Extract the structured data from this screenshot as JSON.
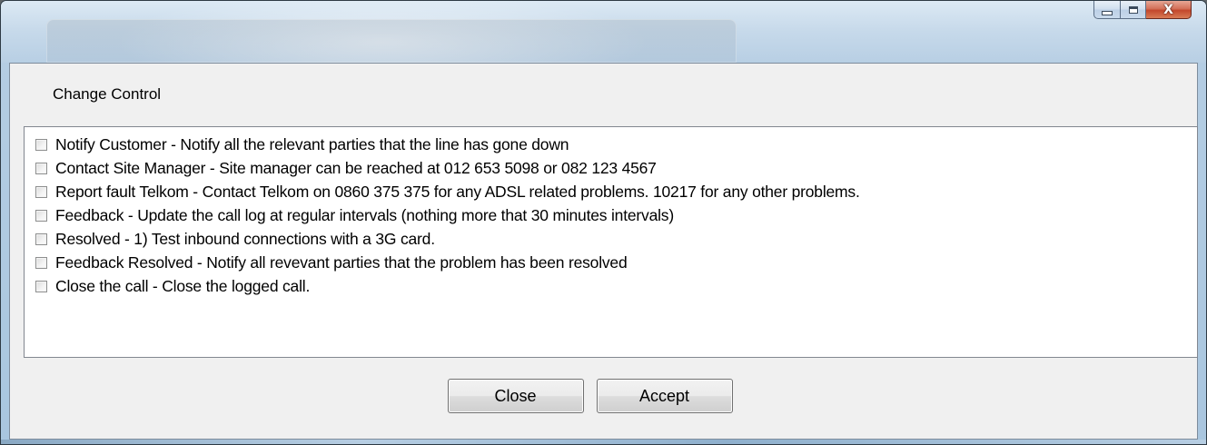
{
  "window": {
    "caption_buttons": {
      "minimize_icon": "minimize-icon",
      "maximize_icon": "maximize-icon",
      "close_icon": "close-icon",
      "close_glyph": "X"
    },
    "colors": {
      "close_button": "#c3472c",
      "client_background": "#f0f0f0"
    }
  },
  "group": {
    "label": "Change Control"
  },
  "checklist": {
    "items": [
      {
        "label": "Notify Customer - Notify all the relevant parties that the line has gone down",
        "checked": false
      },
      {
        "label": "Contact Site Manager - Site manager can be reached at 012 653 5098 or 082 123 4567",
        "checked": false
      },
      {
        "label": "Report fault Telkom  - Contact Telkom on 0860 375 375 for any ADSL related problems. 10217 for any other problems.",
        "checked": false
      },
      {
        "label": "Feedback  - Update the call log at regular intervals (nothing more that 30 minutes intervals)",
        "checked": false
      },
      {
        "label": "Resolved - 1) Test inbound connections with a 3G card.",
        "checked": false
      },
      {
        "label": "Feedback Resolved - Notify all revevant parties that the problem has been resolved",
        "checked": false
      },
      {
        "label": "Close the call - Close the logged call.",
        "checked": false
      }
    ]
  },
  "footer": {
    "close_label": "Close",
    "accept_label": "Accept"
  }
}
